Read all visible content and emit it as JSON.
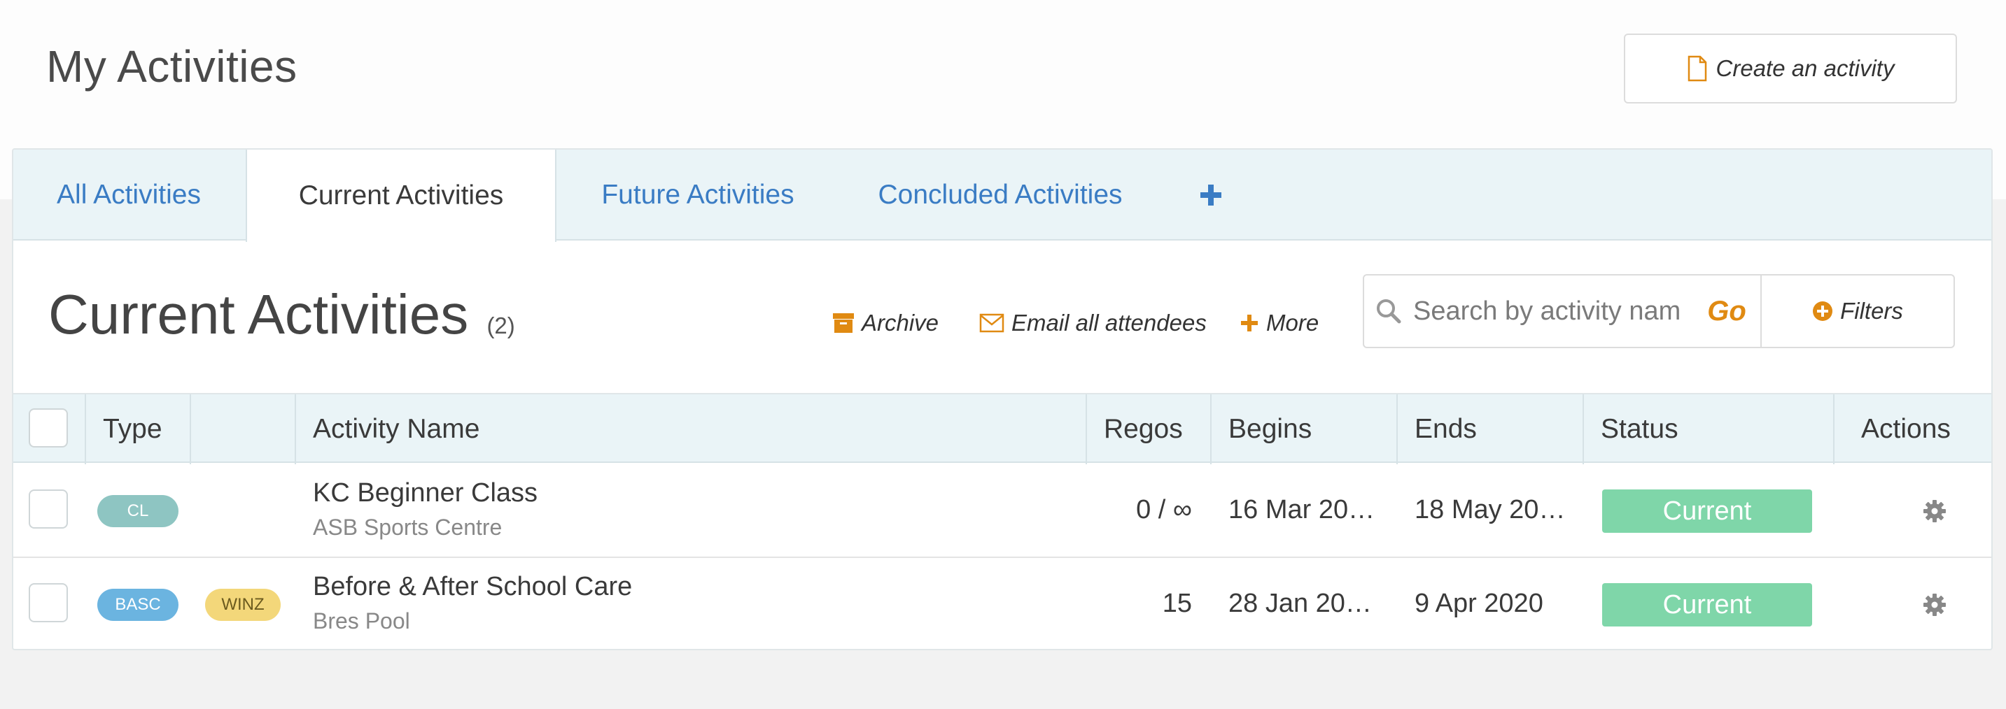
{
  "page": {
    "title": "My Activities",
    "create_label": "Create an activity"
  },
  "tabs": [
    {
      "label": "All Activities",
      "active": false
    },
    {
      "label": "Current Activities",
      "active": true
    },
    {
      "label": "Future Activities",
      "active": false
    },
    {
      "label": "Concluded Activities",
      "active": false
    }
  ],
  "section": {
    "title": "Current Activities",
    "count": "(2)"
  },
  "toolbar": {
    "archive_label": "Archive",
    "email_label": "Email all attendees",
    "more_label": "More",
    "search_placeholder": "Search by activity nam",
    "go_label": "Go",
    "filters_label": "Filters"
  },
  "table": {
    "headers": {
      "type": "Type",
      "name": "Activity Name",
      "regos": "Regos",
      "begins": "Begins",
      "ends": "Ends",
      "status": "Status",
      "actions": "Actions"
    },
    "rows": [
      {
        "badge1": "CL",
        "badge2": "",
        "name": "KC Beginner Class",
        "venue": "ASB Sports Centre",
        "regos": "0 / ∞",
        "begins": "16 Mar 20…",
        "ends": "18 May 20…",
        "status": "Current"
      },
      {
        "badge1": "BASC",
        "badge2": "WINZ",
        "name": "Before & After School Care",
        "venue": "Bres Pool",
        "regos": "15",
        "begins": "28 Jan 20…",
        "ends": "9 Apr 2020",
        "status": "Current"
      }
    ]
  },
  "colors": {
    "accent_blue": "#3a7cc4",
    "accent_orange": "#e08a12",
    "status_green": "#7fd6a9",
    "badge_cl": "#8ec5c2",
    "badge_basc": "#6bb4e0",
    "badge_winz": "#f3d77a"
  },
  "icons": {
    "create": "file-icon",
    "archive": "archive-icon",
    "email": "envelope-icon",
    "more": "plus-icon",
    "search": "search-icon",
    "filters": "plus-circle-icon",
    "actions": "gear-icon"
  }
}
